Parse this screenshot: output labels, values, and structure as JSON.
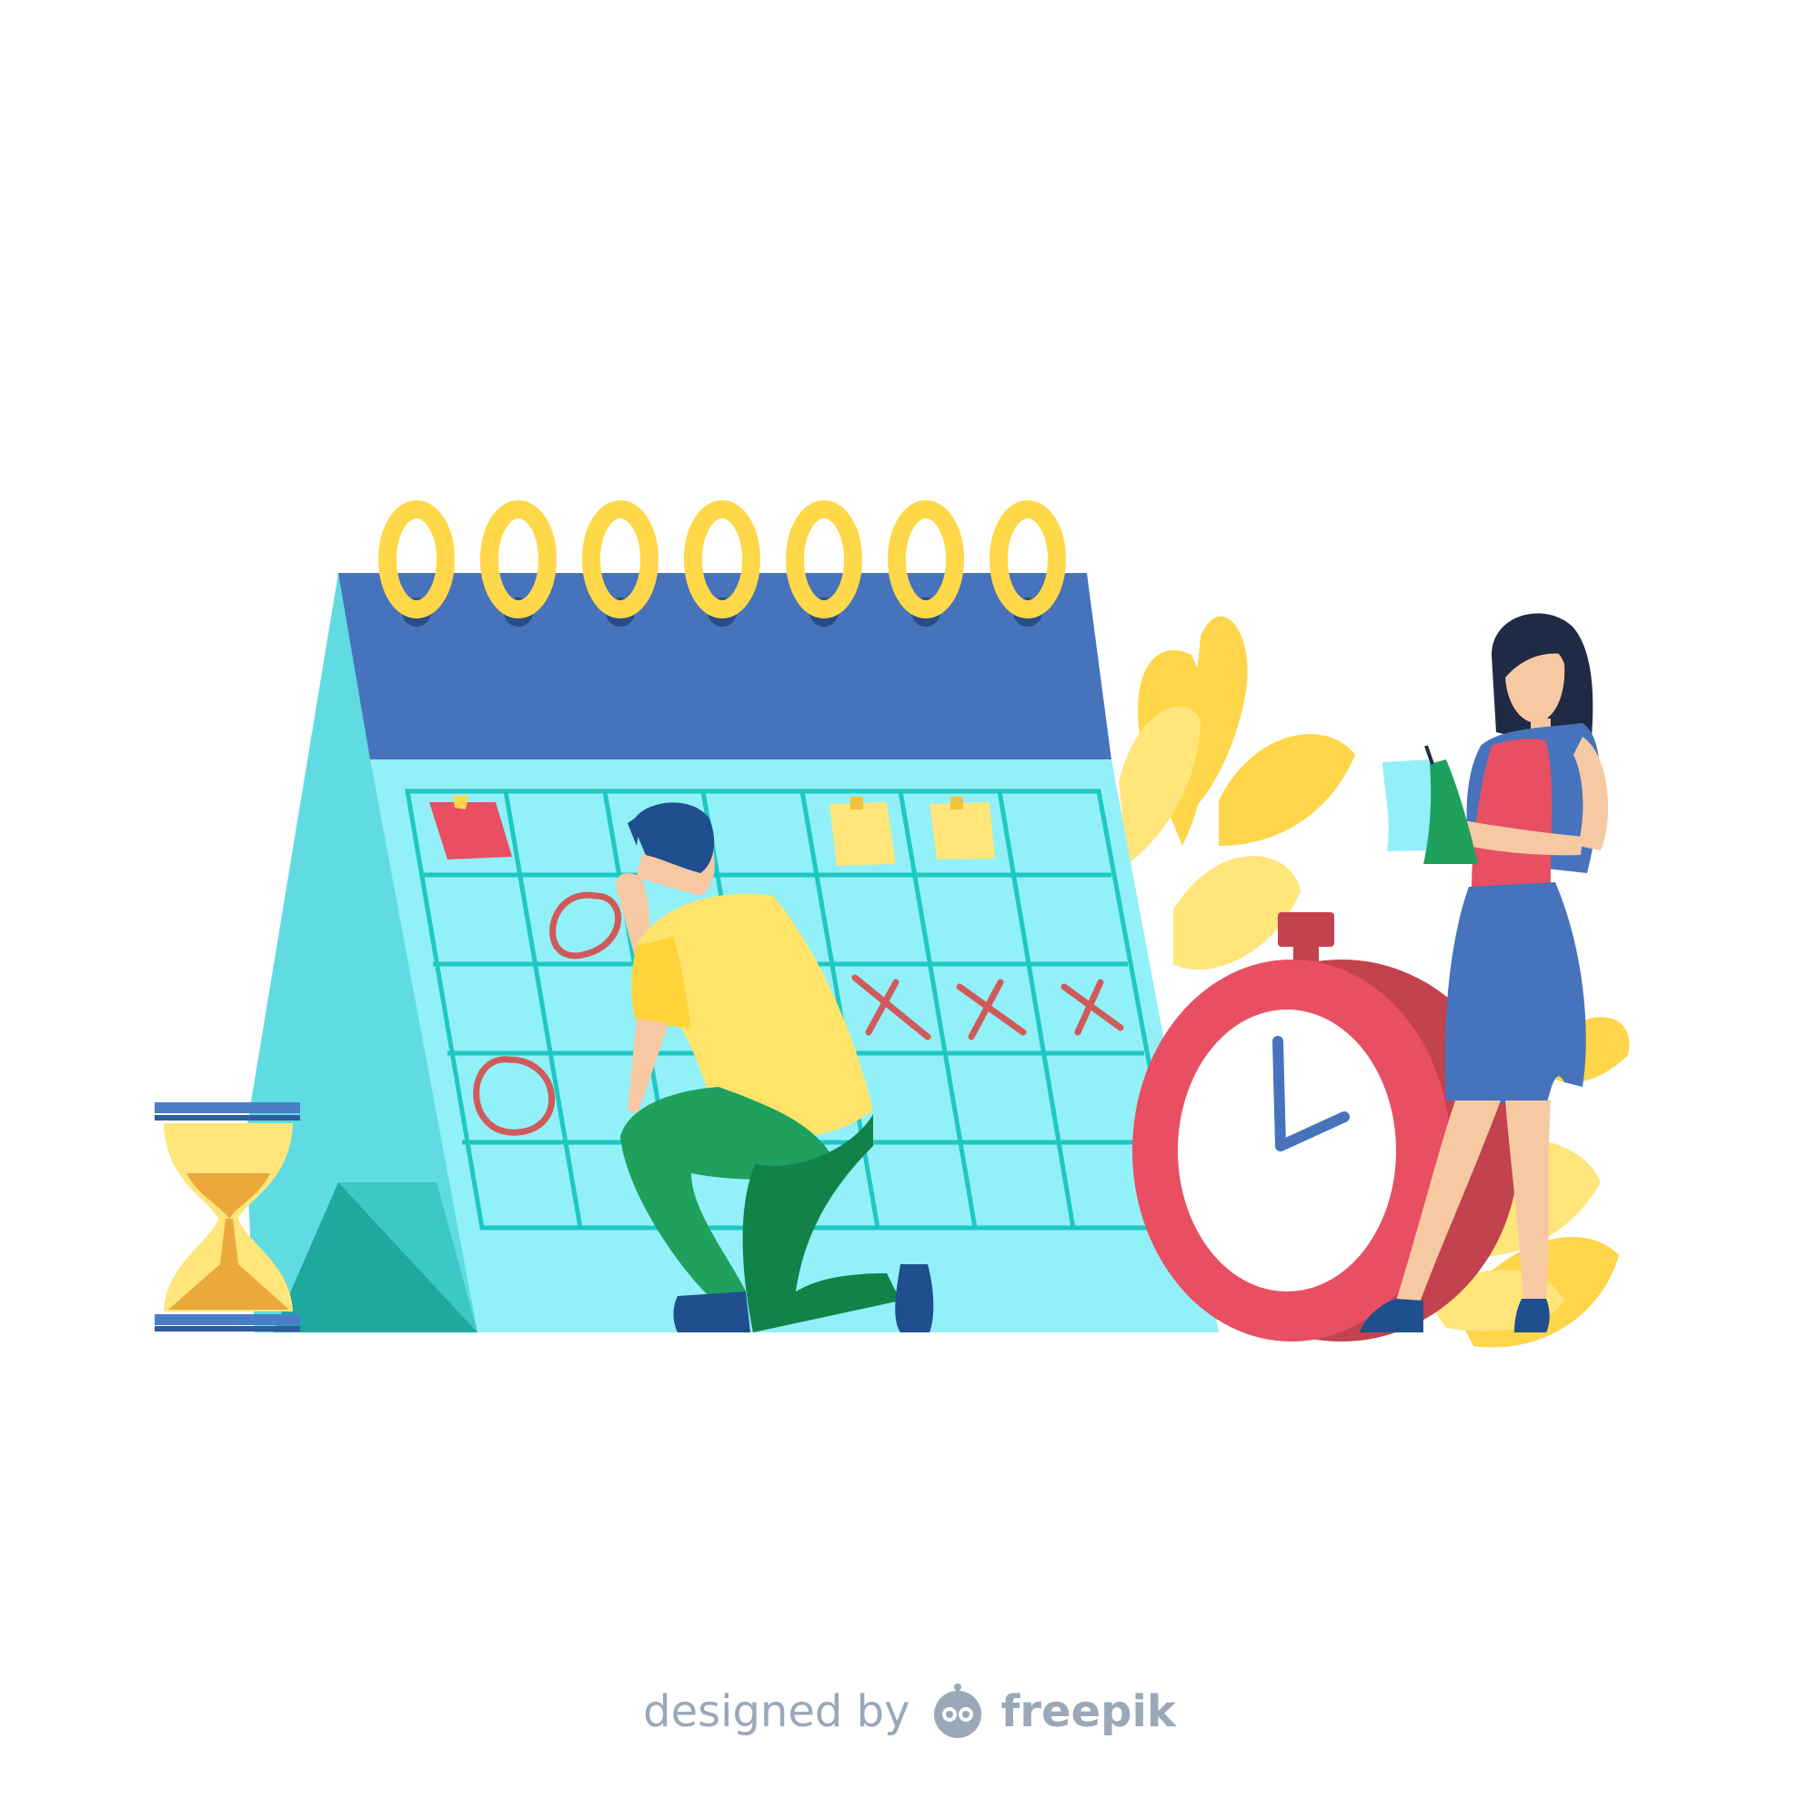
{
  "credit": {
    "prefix": "designed by",
    "brand": "freepik"
  },
  "colors": {
    "calendar_back": "#5fdbe1",
    "calendar_header": "#4673bb",
    "calendar_page": "#92f0f8",
    "grid_line": "#1ec8c2",
    "ring": "#ffd84a",
    "ink_red": "#d05a5a",
    "clock_red": "#e84f63",
    "clock_dark_red": "#c2424d",
    "leaf_yellow": "#ffd54a",
    "shirt_yellow": "#ffe36b",
    "pants_green": "#1fa05c",
    "hair_navy": "#1f4f8f",
    "skirt_blue": "#4673bb",
    "top_pink": "#e84f63",
    "skin": "#f7c9a3",
    "hourglass_blue": "#4a7fc8",
    "sand": "#eba83b",
    "credit_gray": "#9aa8b8"
  },
  "icons": [
    "calendar-illustration",
    "hourglass-icon",
    "alarm-clock-icon",
    "freepik-logo-icon"
  ]
}
